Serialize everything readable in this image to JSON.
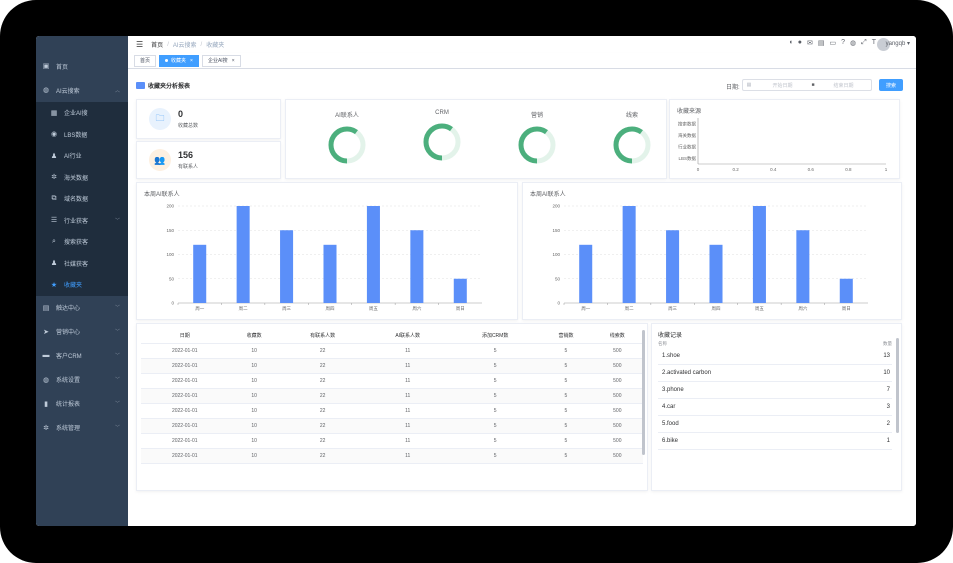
{
  "sidebar": {
    "items": [
      {
        "label": "首页",
        "icon": "dashboard-icon"
      },
      {
        "label": "AI云搜索",
        "icon": "globe-icon",
        "expanded": true
      },
      {
        "label": "企业AI搜",
        "icon": "building-icon",
        "sub": true
      },
      {
        "label": "LBS数据",
        "icon": "location-icon",
        "sub": true
      },
      {
        "label": "AI行业",
        "icon": "user-icon",
        "sub": true
      },
      {
        "label": "海关数据",
        "icon": "gear-icon",
        "sub": true
      },
      {
        "label": "域名数据",
        "icon": "link-icon",
        "sub": true
      },
      {
        "label": "行业获客",
        "icon": "list-icon",
        "sub": true,
        "arrow": true
      },
      {
        "label": "搜索获客",
        "icon": "search-icon",
        "sub": true
      },
      {
        "label": "社媒获客",
        "icon": "user-icon",
        "sub": true
      },
      {
        "label": "收藏夹",
        "icon": "star-icon",
        "sub": true,
        "active": true
      },
      {
        "label": "触达中心",
        "icon": "message-icon",
        "arrow": true
      },
      {
        "label": "营销中心",
        "icon": "send-icon",
        "arrow": true
      },
      {
        "label": "客户CRM",
        "icon": "crm-icon",
        "arrow": true
      },
      {
        "label": "系统设置",
        "icon": "globe-icon",
        "arrow": true
      },
      {
        "label": "统计报表",
        "icon": "bar-chart-icon",
        "arrow": true
      },
      {
        "label": "系统管理",
        "icon": "gear-icon",
        "arrow": true
      }
    ]
  },
  "topbar": {
    "breadcrumb": [
      "首页",
      "AI云搜索",
      "收藏夹"
    ],
    "username": "yangqb"
  },
  "tags": [
    {
      "label": "首页",
      "active": false
    },
    {
      "label": "收藏夹",
      "active": true
    },
    {
      "label": "企业AI搜",
      "active": false
    }
  ],
  "page": {
    "title": "收藏夹分析报表",
    "date_label": "日期:",
    "start_placeholder": "开始日期",
    "end_placeholder": "结束日期",
    "search_label": "搜索"
  },
  "stats": [
    {
      "value": "0",
      "label": "收藏总数",
      "color": "#4a9ff5",
      "bg": "#e8f2fd"
    },
    {
      "value": "156",
      "label": "有联系人",
      "color": "#f0a04b",
      "bg": "#fdf0e1"
    }
  ],
  "donuts": [
    {
      "label": "AI联系人",
      "fraction": 0.6
    },
    {
      "label": "CRM",
      "fraction": 0.6
    },
    {
      "label": "营销",
      "fraction": 0.6
    },
    {
      "label": "线索",
      "fraction": 0.6
    }
  ],
  "colors": {
    "accent": "#409eff",
    "bar": "#5b8ff9",
    "donut": "#4caf7d",
    "donut_bg": "#e3f3ea"
  },
  "chart_data": [
    {
      "type": "bar",
      "title": "收藏来源",
      "categories": [
        "搜索数据",
        "海关数据",
        "行业数据",
        "LBS数据"
      ],
      "values": [
        0,
        0,
        0,
        0
      ],
      "orientation": "horizontal",
      "xlim": [
        0,
        1
      ],
      "xticks": [
        "0",
        "0.2",
        "0.4",
        "0.6",
        "0.8",
        "1"
      ]
    },
    {
      "type": "bar",
      "title": "本周AI联系人",
      "categories": [
        "周一",
        "周二",
        "周三",
        "周四",
        "周五",
        "周六",
        "周日"
      ],
      "values": [
        120,
        200,
        150,
        120,
        200,
        150,
        50
      ],
      "ylim": [
        0,
        200
      ],
      "yticks": [
        "0",
        "50",
        "100",
        "150",
        "200"
      ]
    },
    {
      "type": "bar",
      "title": "本周AI联系人",
      "categories": [
        "周一",
        "周二",
        "周三",
        "周四",
        "周五",
        "周六",
        "周日"
      ],
      "values": [
        120,
        200,
        150,
        120,
        200,
        150,
        50
      ],
      "ylim": [
        0,
        200
      ],
      "yticks": [
        "0",
        "50",
        "100",
        "150",
        "200"
      ]
    }
  ],
  "table": {
    "headers": [
      "日期",
      "收藏数",
      "有联系人数",
      "AI联系人数",
      "添加CRM数",
      "营销数",
      "线索数"
    ],
    "rows": [
      [
        "2022-01-01",
        "10",
        "22",
        "11",
        "5",
        "5",
        "500"
      ],
      [
        "2022-01-01",
        "10",
        "22",
        "11",
        "5",
        "5",
        "500"
      ],
      [
        "2022-01-01",
        "10",
        "22",
        "11",
        "5",
        "5",
        "500"
      ],
      [
        "2022-01-01",
        "10",
        "22",
        "11",
        "5",
        "5",
        "500"
      ],
      [
        "2022-01-01",
        "10",
        "22",
        "11",
        "5",
        "5",
        "500"
      ],
      [
        "2022-01-01",
        "10",
        "22",
        "11",
        "5",
        "5",
        "500"
      ],
      [
        "2022-01-01",
        "10",
        "22",
        "11",
        "5",
        "5",
        "500"
      ],
      [
        "2022-01-01",
        "10",
        "22",
        "11",
        "5",
        "5",
        "500"
      ]
    ]
  },
  "records": {
    "title": "收藏记录",
    "col_name": "名称",
    "col_count": "数量",
    "items": [
      {
        "name": "1.shoe",
        "count": "13"
      },
      {
        "name": "2.activated carbon",
        "count": "10"
      },
      {
        "name": "3.phone",
        "count": "7"
      },
      {
        "name": "4.car",
        "count": "3"
      },
      {
        "name": "5.food",
        "count": "2"
      },
      {
        "name": "6.bike",
        "count": "1"
      }
    ]
  }
}
